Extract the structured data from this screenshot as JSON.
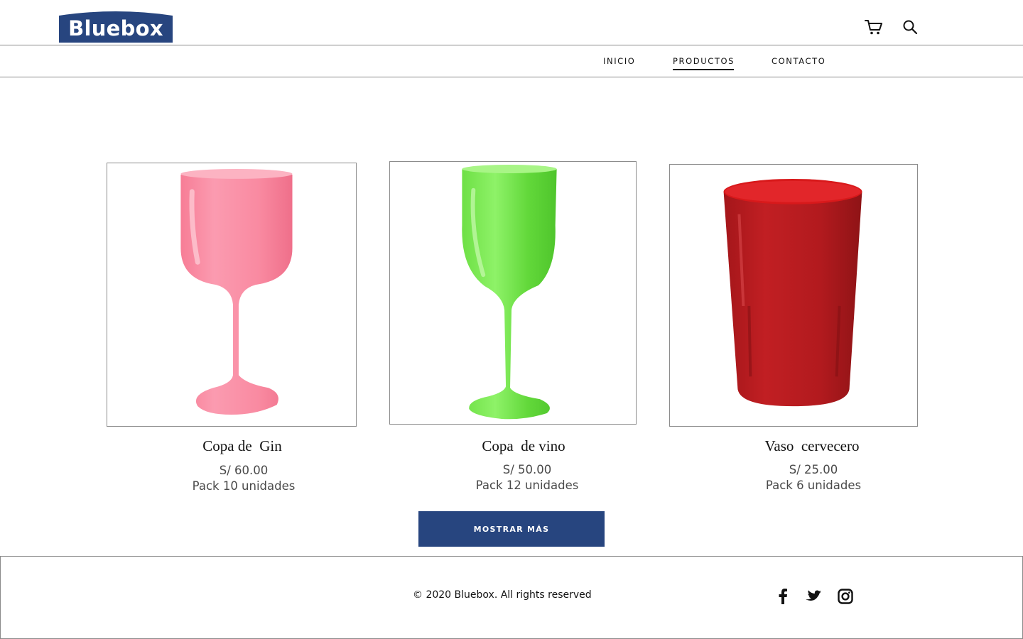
{
  "brand": {
    "name": "Bluebox",
    "color": "#27457f"
  },
  "header": {
    "icons": [
      "cart-icon",
      "search-icon"
    ]
  },
  "nav": {
    "items": [
      {
        "label": "INICIO",
        "active": false
      },
      {
        "label": "PRODUCTOS",
        "active": true
      },
      {
        "label": "CONTACTO",
        "active": false
      }
    ]
  },
  "products": [
    {
      "name": "Copa de  Gin",
      "price": "S/ 60.00",
      "pack": "Pack 10 unidades",
      "color": "#f98aa0",
      "image": "pink-gin-glass"
    },
    {
      "name": "Copa  de vino",
      "price": "S/ 50.00",
      "pack": "Pack 12 unidades",
      "color": "#66dd3c",
      "image": "green-wine-glass"
    },
    {
      "name": "Vaso  cervecero",
      "price": "S/ 25.00",
      "pack": "Pack 6 unidades",
      "color": "#b51a1e",
      "image": "red-beer-tumbler"
    }
  ],
  "show_more": {
    "label": "MOSTRAR MÁS"
  },
  "footer": {
    "copyright": "© 2020 Bluebox. All rights reserved",
    "social": [
      "facebook-icon",
      "twitter-icon",
      "instagram-icon"
    ]
  }
}
